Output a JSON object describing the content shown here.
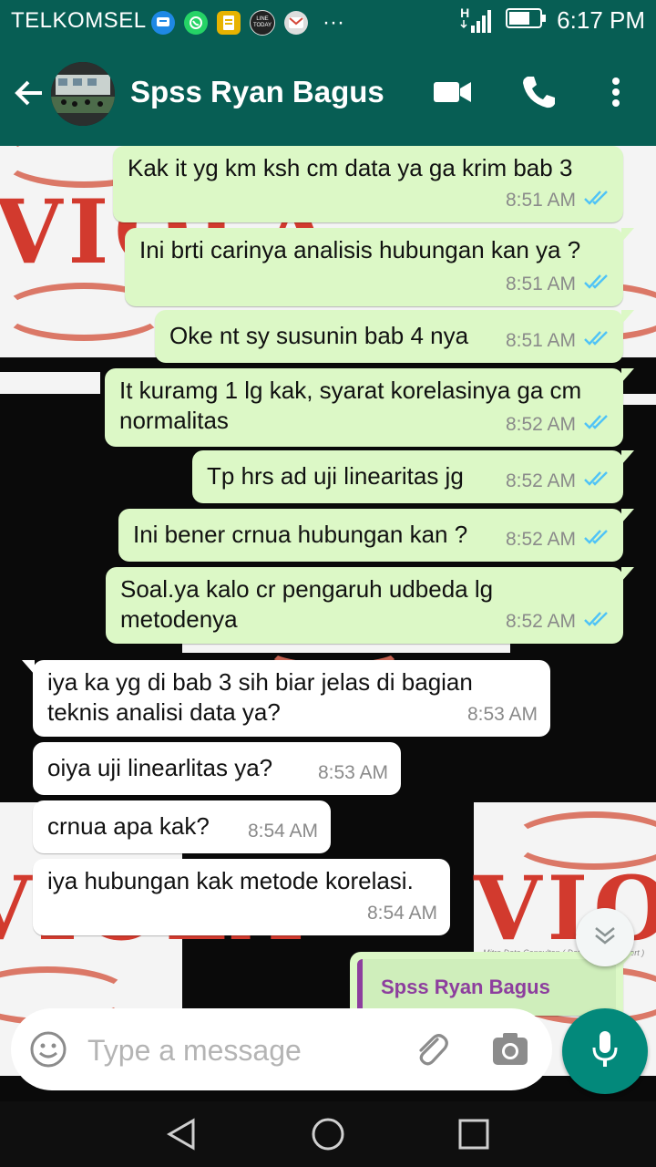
{
  "status_bar": {
    "carrier": "TELKOMSEL",
    "notification_icons": [
      "bbm-icon",
      "whatsapp-icon",
      "notes-icon",
      "line-today-icon",
      "gmail-icon"
    ],
    "line_today_label": "LINE TODAY",
    "more_label": "···",
    "network": "H",
    "time": "6:17 PM"
  },
  "header": {
    "contact_name": "Spss Ryan Bagus"
  },
  "colors": {
    "header_bg": "#075e54",
    "outgoing_bubble": "#dcf8c6",
    "incoming_bubble": "#ffffff",
    "read_ticks": "#4fc3f7",
    "mic_button": "#03897b",
    "quote_name": "#8d3e9e"
  },
  "messages": [
    {
      "direction": "out",
      "text": "Kak it yg km ksh cm data ya ga krim bab 3",
      "time": "8:51 AM",
      "status": "read"
    },
    {
      "direction": "out",
      "text": "Ini brti carinya analisis hubungan kan ya ?",
      "time": "8:51 AM",
      "status": "read"
    },
    {
      "direction": "out",
      "text": "Oke nt sy susunin bab 4 nya",
      "time": "8:51 AM",
      "status": "read"
    },
    {
      "direction": "out",
      "text": "It kuramg 1 lg kak, syarat korelasinya ga cm normalitas",
      "time": "8:52 AM",
      "status": "read"
    },
    {
      "direction": "out",
      "text": "Tp hrs ad uji linearitas jg",
      "time": "8:52 AM",
      "status": "read"
    },
    {
      "direction": "out",
      "text": "Ini bener crnua hubungan kan ?",
      "time": "8:52 AM",
      "status": "read"
    },
    {
      "direction": "out",
      "text": "Soal.ya kalo cr pengaruh udbeda lg metodenya",
      "time": "8:52 AM",
      "status": "read"
    },
    {
      "direction": "in",
      "text": "iya ka yg di bab 3 sih biar jelas di bagian teknis analisi data ya?",
      "time": "8:53 AM"
    },
    {
      "direction": "in",
      "text": "oiya uji linearlitas ya?",
      "time": "8:53 AM"
    },
    {
      "direction": "in",
      "text": "crnua apa kak?",
      "time": "8:54 AM"
    },
    {
      "direction": "in",
      "text": "iya hubungan kak metode korelasi.",
      "time": "8:54 AM"
    }
  ],
  "quoted_reply": {
    "sender": "Spss Ryan Bagus"
  },
  "wallpaper": {
    "logo_text": "VIOLA",
    "logo_tagline": "Mitra Data Consultan ( Data Analyst Expert )"
  },
  "composer": {
    "placeholder": "Type a message"
  }
}
